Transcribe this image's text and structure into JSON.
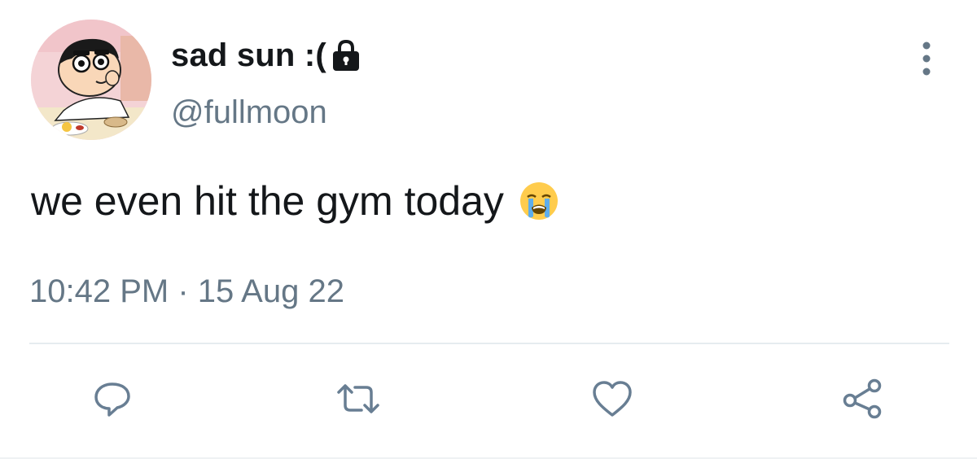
{
  "tweet": {
    "display_name": "sad sun :(",
    "handle": "@fullmoon",
    "text": "we even hit the gym today",
    "emoji": "loudly-crying-face",
    "timestamp": "10:42 PM · 15 Aug 22",
    "account_protected": true
  },
  "icons": {
    "lock": "lock-icon",
    "more": "more-vertical-icon",
    "reply": "reply-icon",
    "retweet": "retweet-icon",
    "like": "like-heart-icon",
    "share": "share-icon"
  },
  "colors": {
    "text": "#14171a",
    "secondary": "#657786",
    "action_icon": "#687e93",
    "divider": "#e6ecf0"
  }
}
